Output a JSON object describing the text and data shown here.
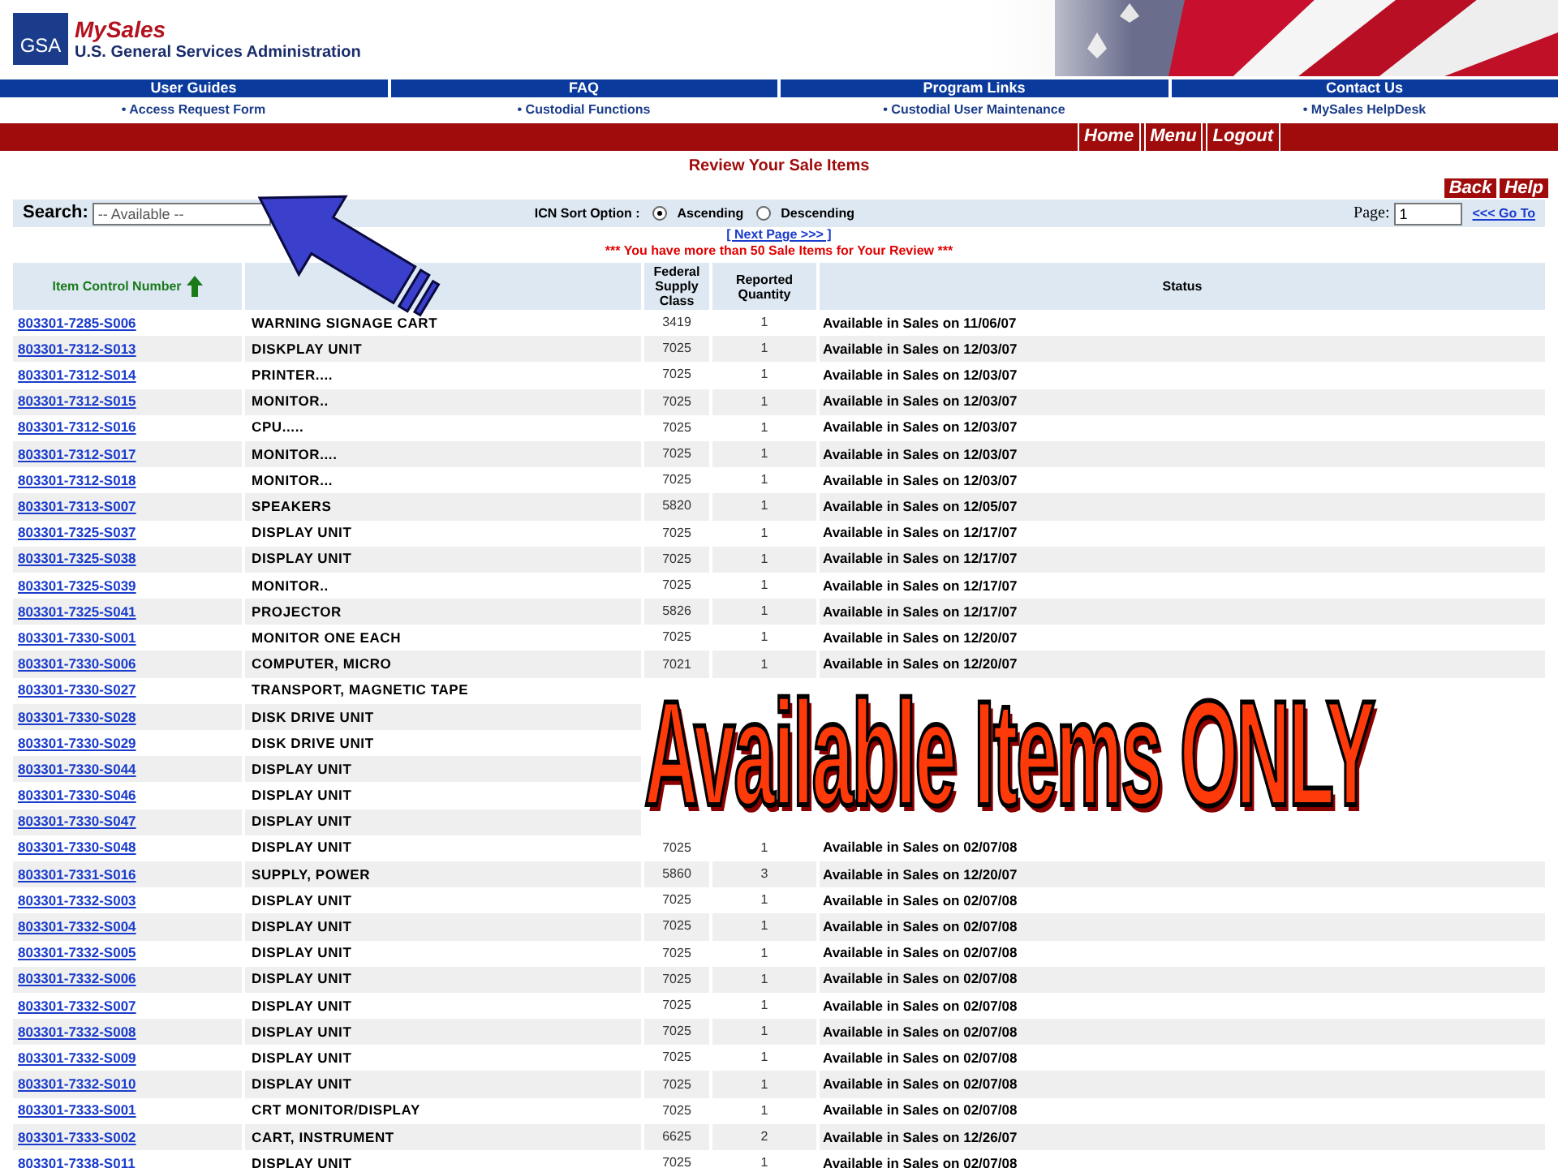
{
  "header": {
    "logo": "GSA",
    "site_name": "MySales",
    "agency": "U.S. General Services Administration"
  },
  "nav": [
    {
      "title": "User Guides",
      "link": "• Access Request Form"
    },
    {
      "title": "FAQ",
      "link": "• Custodial Functions"
    },
    {
      "title": "Program Links",
      "link": "• Custodial User Maintenance"
    },
    {
      "title": "Contact Us",
      "link": "• MySales HelpDesk"
    }
  ],
  "action_bar": [
    "Home",
    "Menu",
    "Logout"
  ],
  "page_title": "Review Your Sale Items",
  "page_buttons": [
    "Back",
    "Help"
  ],
  "search": {
    "label": "Search:",
    "value": "-- Available --"
  },
  "sort": {
    "label": "ICN Sort Option :",
    "options": [
      {
        "label": "Ascending",
        "selected": true
      },
      {
        "label": "Descending",
        "selected": false
      }
    ]
  },
  "paging": {
    "label": "Page:",
    "value": "1",
    "go": "<<< Go To",
    "next": "[ Next Page >>> ]"
  },
  "notice": "*** You have more than 50 Sale Items for Your Review ***",
  "table": {
    "columns": {
      "icn": "Item Control Number",
      "fsc": "Federal Supply Class",
      "qty": "Reported Quantity",
      "status": "Status"
    },
    "rows": [
      {
        "icn": "803301-7285-S006",
        "name": "WARNING SIGNAGE CART",
        "fsc": "3419",
        "qty": "1",
        "status": "Available in Sales on 11/06/07"
      },
      {
        "icn": "803301-7312-S013",
        "name": "DISKPLAY UNIT",
        "fsc": "7025",
        "qty": "1",
        "status": "Available in Sales on 12/03/07"
      },
      {
        "icn": "803301-7312-S014",
        "name": "PRINTER....",
        "fsc": "7025",
        "qty": "1",
        "status": "Available in Sales on 12/03/07"
      },
      {
        "icn": "803301-7312-S015",
        "name": "MONITOR..",
        "fsc": "7025",
        "qty": "1",
        "status": "Available in Sales on 12/03/07"
      },
      {
        "icn": "803301-7312-S016",
        "name": "CPU.....",
        "fsc": "7025",
        "qty": "1",
        "status": "Available in Sales on 12/03/07"
      },
      {
        "icn": "803301-7312-S017",
        "name": "MONITOR....",
        "fsc": "7025",
        "qty": "1",
        "status": "Available in Sales on 12/03/07"
      },
      {
        "icn": "803301-7312-S018",
        "name": "MONITOR...",
        "fsc": "7025",
        "qty": "1",
        "status": "Available in Sales on 12/03/07"
      },
      {
        "icn": "803301-7313-S007",
        "name": "SPEAKERS",
        "fsc": "5820",
        "qty": "1",
        "status": "Available in Sales on 12/05/07"
      },
      {
        "icn": "803301-7325-S037",
        "name": "DISPLAY UNIT",
        "fsc": "7025",
        "qty": "1",
        "status": "Available in Sales on 12/17/07"
      },
      {
        "icn": "803301-7325-S038",
        "name": "DISPLAY UNIT",
        "fsc": "7025",
        "qty": "1",
        "status": "Available in Sales on 12/17/07"
      },
      {
        "icn": "803301-7325-S039",
        "name": "MONITOR..",
        "fsc": "7025",
        "qty": "1",
        "status": "Available in Sales on 12/17/07"
      },
      {
        "icn": "803301-7325-S041",
        "name": "PROJECTOR",
        "fsc": "5826",
        "qty": "1",
        "status": "Available in Sales on 12/17/07"
      },
      {
        "icn": "803301-7330-S001",
        "name": "MONITOR ONE EACH",
        "fsc": "7025",
        "qty": "1",
        "status": "Available in Sales on 12/20/07"
      },
      {
        "icn": "803301-7330-S006",
        "name": "COMPUTER, MICRO",
        "fsc": "7021",
        "qty": "1",
        "status": "Available in Sales on 12/20/07"
      },
      {
        "icn": "803301-7330-S027",
        "name": "TRANSPORT, MAGNETIC TAPE"
      },
      {
        "icn": "803301-7330-S028",
        "name": "DISK DRIVE UNIT"
      },
      {
        "icn": "803301-7330-S029",
        "name": "DISK DRIVE UNIT"
      },
      {
        "icn": "803301-7330-S044",
        "name": "DISPLAY UNIT"
      },
      {
        "icn": "803301-7330-S046",
        "name": "DISPLAY UNIT"
      },
      {
        "icn": "803301-7330-S047",
        "name": "DISPLAY UNIT"
      },
      {
        "icn": "803301-7330-S048",
        "name": "DISPLAY UNIT",
        "fsc": "7025",
        "qty": "1",
        "status": "Available in Sales on 02/07/08"
      },
      {
        "icn": "803301-7331-S016",
        "name": "SUPPLY, POWER",
        "fsc": "5860",
        "qty": "3",
        "status": "Available in Sales on 12/20/07"
      },
      {
        "icn": "803301-7332-S003",
        "name": "DISPLAY UNIT",
        "fsc": "7025",
        "qty": "1",
        "status": "Available in Sales on 02/07/08"
      },
      {
        "icn": "803301-7332-S004",
        "name": "DISPLAY UNIT",
        "fsc": "7025",
        "qty": "1",
        "status": "Available in Sales on 02/07/08"
      },
      {
        "icn": "803301-7332-S005",
        "name": "DISPLAY UNIT",
        "fsc": "7025",
        "qty": "1",
        "status": "Available in Sales on 02/07/08"
      },
      {
        "icn": "803301-7332-S006",
        "name": "DISPLAY UNIT",
        "fsc": "7025",
        "qty": "1",
        "status": "Available in Sales on 02/07/08"
      },
      {
        "icn": "803301-7332-S007",
        "name": "DISPLAY UNIT",
        "fsc": "7025",
        "qty": "1",
        "status": "Available in Sales on 02/07/08"
      },
      {
        "icn": "803301-7332-S008",
        "name": "DISPLAY UNIT",
        "fsc": "7025",
        "qty": "1",
        "status": "Available in Sales on 02/07/08"
      },
      {
        "icn": "803301-7332-S009",
        "name": "DISPLAY UNIT",
        "fsc": "7025",
        "qty": "1",
        "status": "Available in Sales on 02/07/08"
      },
      {
        "icn": "803301-7332-S010",
        "name": "DISPLAY UNIT",
        "fsc": "7025",
        "qty": "1",
        "status": "Available in Sales on 02/07/08"
      },
      {
        "icn": "803301-7333-S001",
        "name": "CRT MONITOR/DISPLAY",
        "fsc": "7025",
        "qty": "1",
        "status": "Available in Sales on 02/07/08"
      },
      {
        "icn": "803301-7333-S002",
        "name": "CART, INSTRUMENT",
        "fsc": "6625",
        "qty": "2",
        "status": "Available in Sales on 12/26/07"
      },
      {
        "icn": "803301-7338-S011",
        "name": "DISPLAY UNIT",
        "fsc": "7025",
        "qty": "1",
        "status": "Available in Sales on 02/07/08"
      }
    ]
  },
  "overlay": {
    "caption": "Available Items ONLY"
  }
}
